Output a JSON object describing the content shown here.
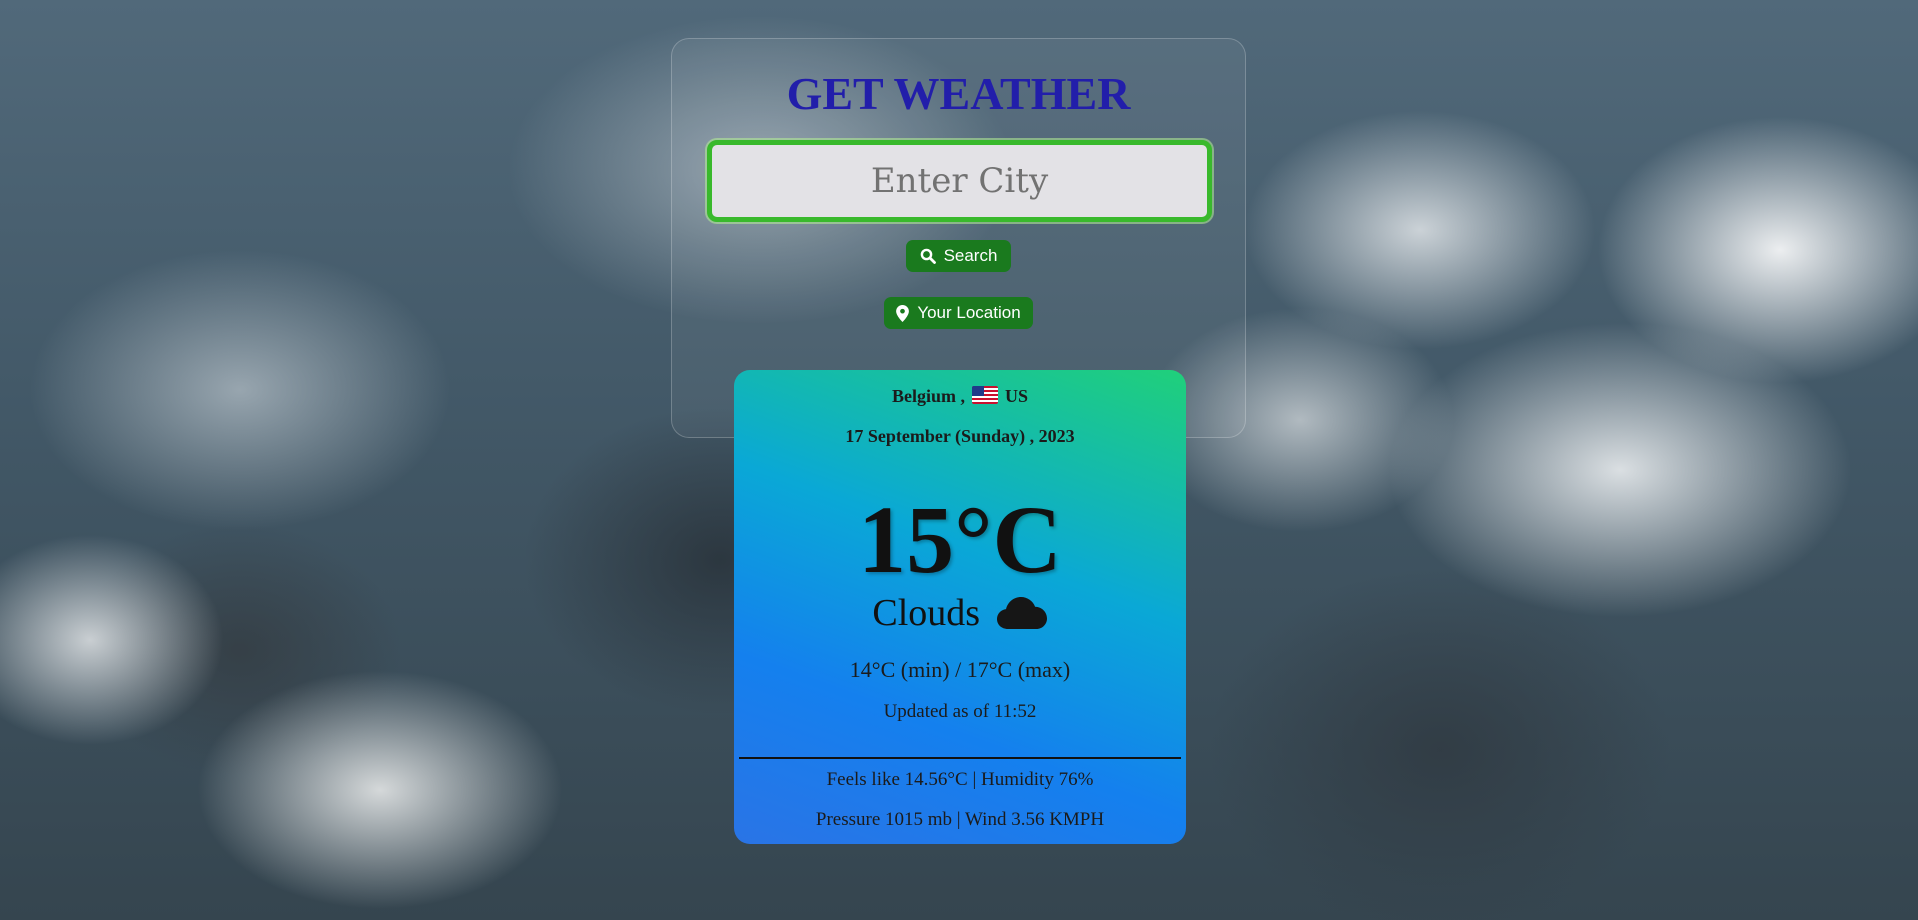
{
  "header": {
    "title": "GET WEATHER"
  },
  "search": {
    "placeholder": "Enter City",
    "value": "",
    "search_label": "Search",
    "location_label": "Your Location"
  },
  "weather": {
    "city": "Belgium",
    "separator": ",",
    "country": "US",
    "date": "17 September (Sunday) , 2023",
    "temperature": "15°C",
    "condition": "Clouds",
    "min_max": "14°C (min) / 17°C (max)",
    "updated": "Updated as of 11:52",
    "feels_humidity": "Feels like 14.56°C | Humidity 76%",
    "pressure_wind": "Pressure 1015 mb | Wind 3.56 KMPH"
  },
  "icons": {
    "search": "search-icon",
    "location": "map-pin-icon",
    "condition": "cloud-icon",
    "flag": "us-flag-icon"
  },
  "colors": {
    "title": "#221eaa",
    "button": "#1a7a1e",
    "input_border": "#39b92c",
    "card_gradient_start": "#2a74e6",
    "card_gradient_end": "#20d07a"
  }
}
